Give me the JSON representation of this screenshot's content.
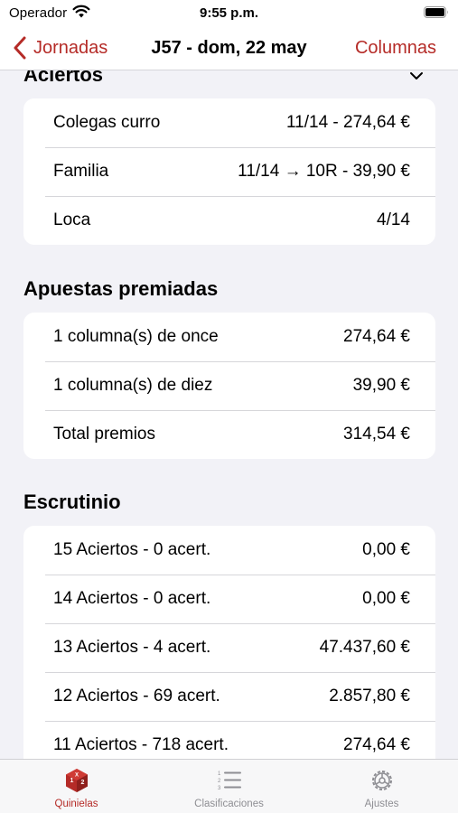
{
  "status_bar": {
    "carrier": "Operador",
    "time": "9:55 p.m."
  },
  "nav": {
    "back_label": "Jornadas",
    "title": "J57 - dom, 22 may",
    "right_label": "Columnas"
  },
  "sections": {
    "aciertos": {
      "title": "Aciertos",
      "rows": [
        {
          "label": "Colegas curro",
          "value": "11/14 - 274,64 €"
        },
        {
          "label": "Familia",
          "value": "11/14 → 10R - 39,90 €"
        },
        {
          "label": "Loca",
          "value": "4/14"
        }
      ]
    },
    "apuestas": {
      "title": "Apuestas premiadas",
      "rows": [
        {
          "label": "1 columna(s) de once",
          "value": "274,64 €"
        },
        {
          "label": "1 columna(s) de diez",
          "value": "39,90 €"
        },
        {
          "label": "Total premios",
          "value": "314,54 €"
        }
      ]
    },
    "escrutinio": {
      "title": "Escrutinio",
      "rows": [
        {
          "label": "15 Aciertos - 0 acert.",
          "value": "0,00 €"
        },
        {
          "label": "14 Aciertos - 0 acert.",
          "value": "0,00 €"
        },
        {
          "label": "13 Aciertos - 4 acert.",
          "value": "47.437,60 €"
        },
        {
          "label": "12 Aciertos - 69 acert.",
          "value": "2.857,80 €"
        },
        {
          "label": "11 Aciertos - 718 acert.",
          "value": "274,64 €"
        }
      ]
    }
  },
  "tab_bar": {
    "tabs": [
      {
        "label": "Quinielas",
        "icon": "quinielas-icon",
        "active": true
      },
      {
        "label": "Clasificaciones",
        "icon": "numbered-list-icon",
        "active": false
      },
      {
        "label": "Ajustes",
        "icon": "gear-icon",
        "active": false
      }
    ]
  },
  "colors": {
    "accent": "#b52b27",
    "background": "#f2f2f7",
    "card": "#ffffff",
    "inactive_tab": "#8e8e93"
  }
}
